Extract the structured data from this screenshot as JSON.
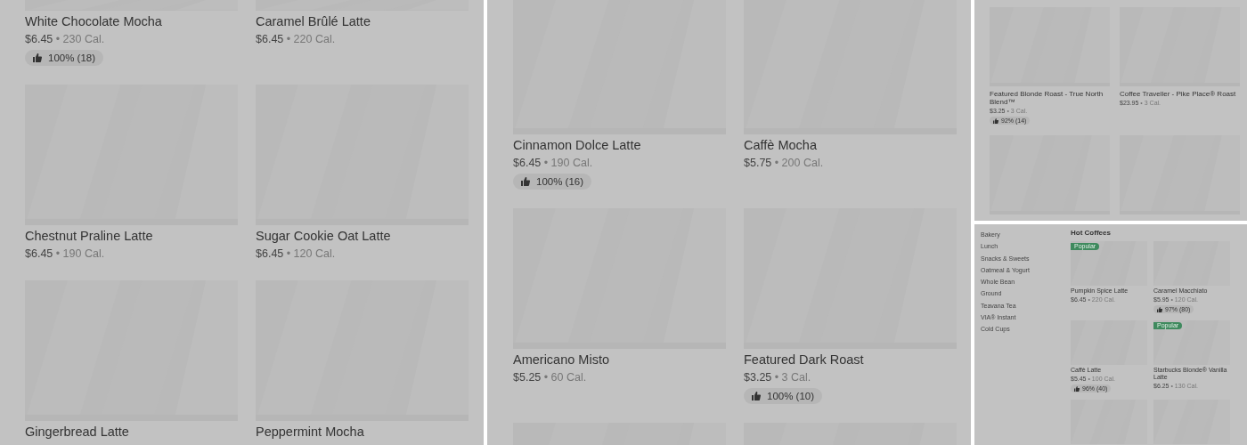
{
  "panels": [
    {
      "kind": "grid",
      "items": [
        {
          "kind": "product",
          "name": "White Chocolate Mocha",
          "price": "$6.45",
          "calories": "• 230 Cal.",
          "rating": "100% (18)"
        },
        {
          "kind": "product",
          "name": "Caramel Brûlé Latte",
          "price": "$6.45",
          "calories": "• 220 Cal."
        },
        {
          "kind": "product",
          "name": "Chestnut Praline Latte",
          "price": "$6.45",
          "calories": "• 190 Cal."
        },
        {
          "kind": "product",
          "name": "Sugar Cookie Oat Latte",
          "price": "$6.45",
          "calories": "• 120 Cal."
        },
        {
          "kind": "product",
          "name": "Gingerbread Latte"
        },
        {
          "kind": "product",
          "name": "Peppermint Mocha"
        }
      ]
    },
    {
      "kind": "grid",
      "items": [
        {
          "kind": "product",
          "name": "Cinnamon Dolce Latte",
          "price": "$6.45",
          "calories": "• 190 Cal.",
          "rating": "100% (16)"
        },
        {
          "kind": "product",
          "name": "Caffè Mocha",
          "price": "$5.75",
          "calories": "• 200 Cal."
        },
        {
          "kind": "product",
          "name": "Americano Misto",
          "price": "$5.25",
          "calories": "• 60 Cal."
        },
        {
          "kind": "product",
          "name": "Featured Dark Roast",
          "price": "$3.25",
          "calories": "• 3 Cal.",
          "rating": "100% (10)"
        },
        {
          "kind": "picture"
        },
        {
          "kind": "picture"
        }
      ]
    },
    {
      "kind": "small-grid",
      "items": [
        {
          "kind": "product",
          "name": "Featured Blonde Roast - True North Blend™",
          "price": "$3.25",
          "calories": "• 3 Cal.",
          "rating": "92% (14)"
        },
        {
          "kind": "product",
          "name": "Coffee Traveller - Pike Place® Roast",
          "price": "$23.95",
          "calories": "• 3 Cal."
        },
        {
          "kind": "picture"
        },
        {
          "kind": "picture"
        }
      ]
    },
    {
      "kind": "menu",
      "categories": [
        "Bakery",
        "Lunch",
        "Snacks & Sweets",
        "Oatmeal & Yogurt",
        "Whole Bean",
        "Ground",
        "Teavana Tea",
        "VIA® Instant",
        "Cold Cups"
      ],
      "heading": "Hot Coffees",
      "items": [
        {
          "kind": "product",
          "name": "Pumpkin Spice Latte",
          "price": "$6.45",
          "calories": "• 220 Cal.",
          "badge": "Popular"
        },
        {
          "kind": "product",
          "name": "Caramel Macchiato",
          "price": "$5.95",
          "calories": "• 120 Cal.",
          "rating": "97% (80)"
        },
        {
          "kind": "product",
          "name": "Caffè Latte",
          "price": "$5.45",
          "calories": "• 100 Cal.",
          "rating": "96% (40)"
        },
        {
          "kind": "product",
          "name": "Starbucks Blonde® Vanilla Latte",
          "price": "$6.25",
          "calories": "• 130 Cal.",
          "badge": "Popular"
        },
        {
          "kind": "picture"
        },
        {
          "kind": "picture"
        }
      ]
    }
  ]
}
